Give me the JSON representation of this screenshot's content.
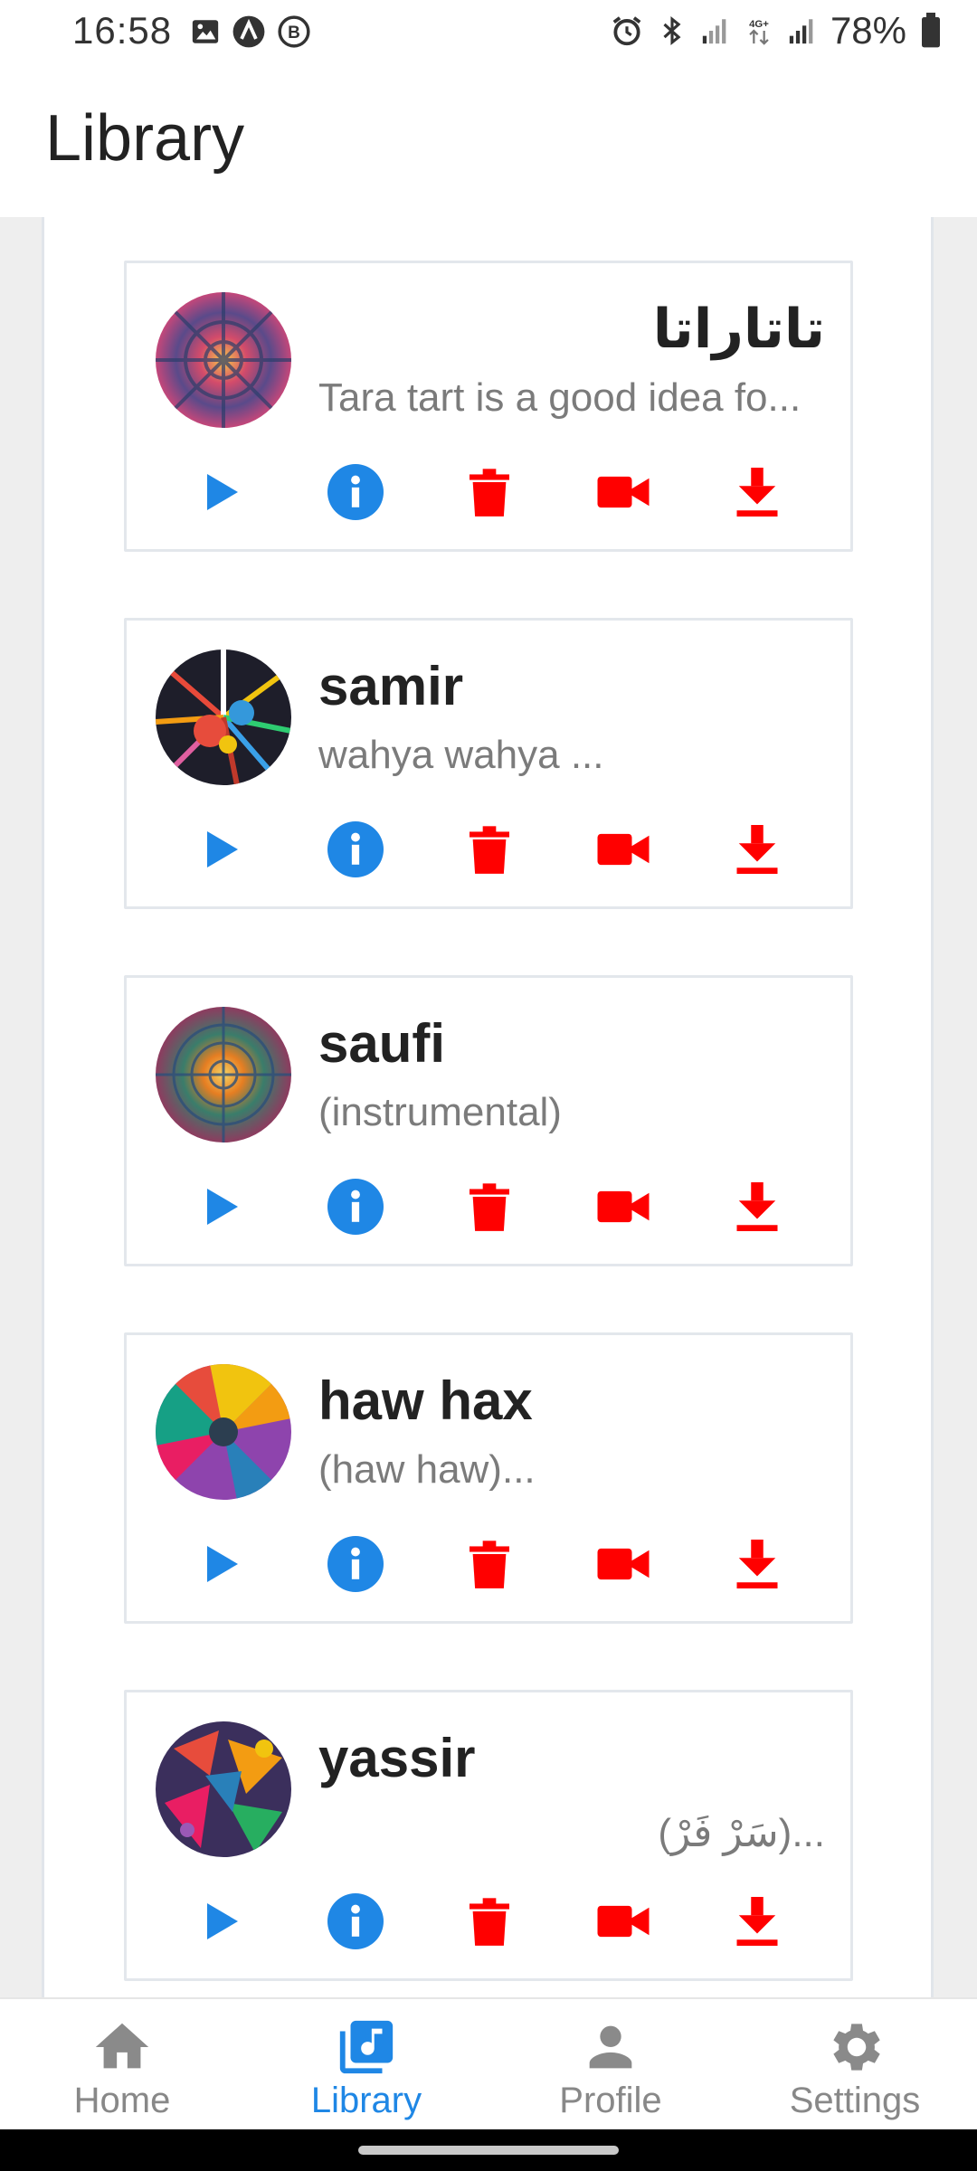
{
  "status_bar": {
    "time": "16:58",
    "battery_pct": "78%",
    "network": "4G+"
  },
  "app_bar": {
    "title": "Library"
  },
  "colors": {
    "accent": "#1f87e5",
    "danger": "#ff0000",
    "play": "#1f87e5"
  },
  "songs": [
    {
      "title": "تاتاراتا",
      "subtitle": "Tara tart is a good idea fo...",
      "rtl_title": true,
      "rtl_sub": false
    },
    {
      "title": "samir",
      "subtitle": "wahya wahya ...",
      "rtl_title": false,
      "rtl_sub": false
    },
    {
      "title": "saufi",
      "subtitle": "(instrumental)",
      "rtl_title": false,
      "rtl_sub": false
    },
    {
      "title": "haw hax",
      "subtitle": "(haw haw)...",
      "rtl_title": false,
      "rtl_sub": false
    },
    {
      "title": "yassir",
      "subtitle": "(سَرْ فَرْ)...",
      "rtl_title": false,
      "rtl_sub": true
    }
  ],
  "actions": {
    "play": "play-icon",
    "info": "info-icon",
    "delete": "trash-icon",
    "video": "video-camera-icon",
    "download": "download-icon"
  },
  "bottom_nav": {
    "items": [
      {
        "label": "Home",
        "icon": "home-icon"
      },
      {
        "label": "Library",
        "icon": "library-music-icon"
      },
      {
        "label": "Profile",
        "icon": "person-icon"
      },
      {
        "label": "Settings",
        "icon": "gear-icon"
      }
    ],
    "active": "Library"
  }
}
